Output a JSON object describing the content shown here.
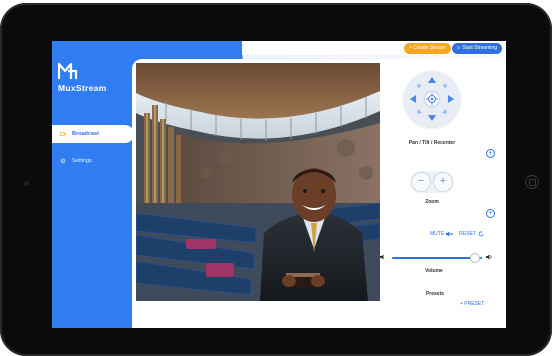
{
  "app": {
    "brand": "MuxStream",
    "brand_color": "#2f7df0"
  },
  "topbar": {
    "create_label": "+ Create Stream",
    "start_label": "▷ Start Streaming"
  },
  "sidebar": {
    "items": [
      {
        "label": "Broadcast",
        "icon": "video-icon",
        "active": true
      },
      {
        "label": "Settings",
        "icon": "gear-icon",
        "active": false
      }
    ]
  },
  "controls": {
    "ptz_label": "Pan / Tilt / Recenter",
    "zoom_label": "Zoom",
    "zoom_out": "−",
    "zoom_in": "+",
    "mute_label": "MUTE",
    "reset_label": "RESET",
    "volume_label": "Volume",
    "volume_level": 0.92,
    "presets_label": "Presets",
    "add_preset_label": "+ PRESET",
    "add_symbol": "+"
  }
}
